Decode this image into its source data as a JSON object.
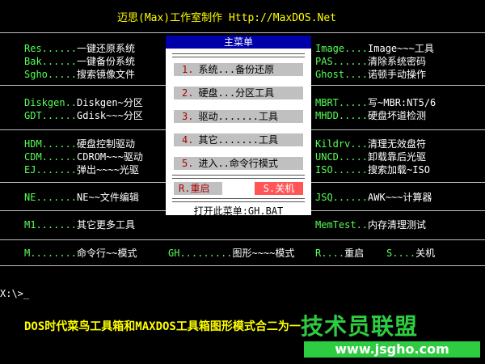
{
  "header": {
    "title": "迈思(Max)工作室制作 Http://MaxDOS.Net"
  },
  "left": [
    {
      "key": "Res......",
      "desc": "一键还原系统"
    },
    {
      "key": "Bak......",
      "desc": "一键备份系统"
    },
    {
      "key": "Sgho.....",
      "desc": "搜索镜像文件"
    },
    {
      "key": "Diskgen..",
      "desc": "Diskgen~分区"
    },
    {
      "key": "GDT......",
      "desc": "Gdisk~~~分区"
    },
    {
      "key": "HDM......",
      "desc": "硬盘控制驱动"
    },
    {
      "key": "CDM......",
      "desc": "CDROM~~~驱动"
    },
    {
      "key": "EJ.......",
      "desc": "弹出~~~~光驱"
    },
    {
      "key": "NE.......",
      "desc": "NE~~文件编辑"
    },
    {
      "key": "M1.......",
      "desc": "其它更多工具"
    },
    {
      "key": "M........",
      "desc": "命令行~~模式"
    }
  ],
  "right": [
    {
      "key": "Image....",
      "desc": "Image~~~工具"
    },
    {
      "key": "PAS......",
      "desc": "清除系统密码"
    },
    {
      "key": "Ghost....",
      "desc": "诺顿手动操作"
    },
    {
      "key": "MBRT.....",
      "desc": "写~MBR:NT5/6"
    },
    {
      "key": "MHDD.....",
      "desc": "硬盘坏道检测"
    },
    {
      "key": "Kildrv...",
      "desc": "清理无效盘符"
    },
    {
      "key": "UNCD.....",
      "desc": "卸载靠后光驱"
    },
    {
      "key": "ISO......",
      "desc": "搜索加载~ISO"
    },
    {
      "key": "JSQ......",
      "desc": "AWK~~~计算器"
    },
    {
      "key": "MemTest..",
      "desc": "内存清理测试"
    }
  ],
  "bottom_row": {
    "gh_key": "GH.........",
    "gh_desc": "图形~~~~模式",
    "r_key": "R....",
    "r_desc": "重启",
    "s_key": "S....",
    "s_desc": "关机"
  },
  "menu": {
    "title": "主菜单",
    "items": [
      {
        "num": "1.",
        "label": "系统...备份还原"
      },
      {
        "num": "2.",
        "label": "硬盘...分区工具"
      },
      {
        "num": "3.",
        "label": "驱动.......工具"
      },
      {
        "num": "4.",
        "label": "其它.......工具"
      },
      {
        "num": "5.",
        "label": "进入..命令行模式"
      }
    ],
    "restart": "R.重启",
    "shutdown": "S.关机",
    "open_hint": "打开此菜单:GH.BAT"
  },
  "prompt": "X:\\>_",
  "footer": "DOS时代菜鸟工具箱和MAXDOS工具箱图形模式合二为一",
  "watermark": {
    "text": "技术员联盟",
    "url": "www.jsgho.com"
  },
  "colors": {
    "background": "#000000",
    "key": "#55ff55",
    "text": "#ffffff",
    "title": "#ffff00",
    "menu_title": "#0000aa",
    "shutdown": "#ff5555"
  }
}
